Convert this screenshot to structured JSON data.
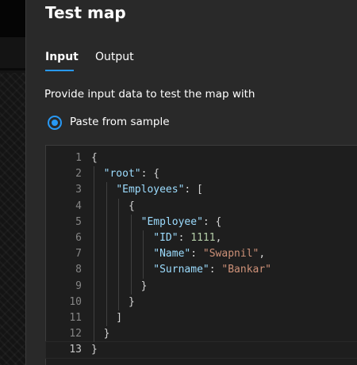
{
  "panel": {
    "title": "Test map",
    "tabs": [
      {
        "label": "Input",
        "selected": true
      },
      {
        "label": "Output",
        "selected": false
      }
    ],
    "description": "Provide input data to test the map with",
    "radio": {
      "label": "Paste from sample",
      "checked": true
    }
  },
  "colors": {
    "accent": "#2899f5",
    "panel_bg": "#292929",
    "editor_bg": "#1e1e1e",
    "json_key": "#9cdcfe",
    "json_string": "#ce9178",
    "json_number": "#b5cea8"
  },
  "editor": {
    "current_line": 13,
    "lines": [
      {
        "n": "1",
        "tokens": [
          [
            "p",
            "{"
          ]
        ]
      },
      {
        "n": "2",
        "tokens": [
          [
            "p",
            "  "
          ],
          [
            "k",
            "\"root\""
          ],
          [
            "p",
            ": {"
          ]
        ]
      },
      {
        "n": "3",
        "tokens": [
          [
            "p",
            "    "
          ],
          [
            "k",
            "\"Employees\""
          ],
          [
            "p",
            ": ["
          ]
        ]
      },
      {
        "n": "4",
        "tokens": [
          [
            "p",
            "      {"
          ]
        ]
      },
      {
        "n": "5",
        "tokens": [
          [
            "p",
            "        "
          ],
          [
            "k",
            "\"Employee\""
          ],
          [
            "p",
            ": {"
          ]
        ]
      },
      {
        "n": "6",
        "tokens": [
          [
            "p",
            "          "
          ],
          [
            "k",
            "\"ID\""
          ],
          [
            "p",
            ": "
          ],
          [
            "n",
            "1111"
          ],
          [
            "p",
            ","
          ]
        ]
      },
      {
        "n": "7",
        "tokens": [
          [
            "p",
            "          "
          ],
          [
            "k",
            "\"Name\""
          ],
          [
            "p",
            ": "
          ],
          [
            "s",
            "\"Swapnil\""
          ],
          [
            "p",
            ","
          ]
        ]
      },
      {
        "n": "8",
        "tokens": [
          [
            "p",
            "          "
          ],
          [
            "k",
            "\"Surname\""
          ],
          [
            "p",
            ": "
          ],
          [
            "s",
            "\"Bankar\""
          ]
        ]
      },
      {
        "n": "9",
        "tokens": [
          [
            "p",
            "        }"
          ]
        ]
      },
      {
        "n": "10",
        "tokens": [
          [
            "p",
            "      }"
          ]
        ]
      },
      {
        "n": "11",
        "tokens": [
          [
            "p",
            "    ]"
          ]
        ]
      },
      {
        "n": "12",
        "tokens": [
          [
            "p",
            "  }"
          ]
        ]
      },
      {
        "n": "13",
        "tokens": [
          [
            "p",
            "}"
          ]
        ]
      }
    ]
  }
}
